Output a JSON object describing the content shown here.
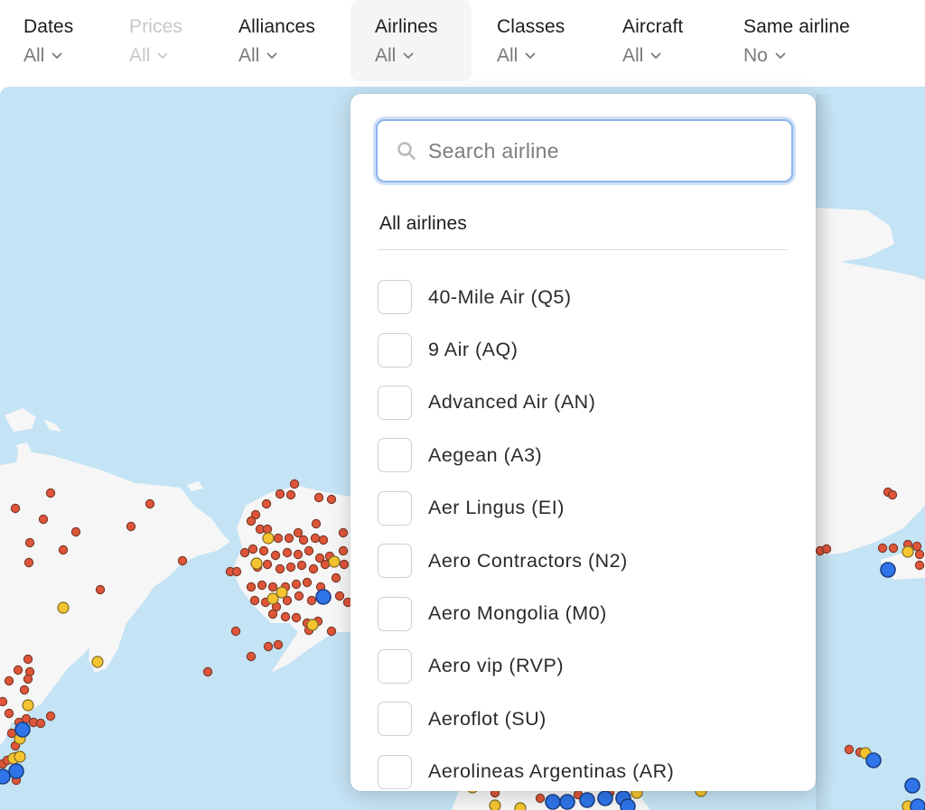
{
  "filters": [
    {
      "label": "Dates",
      "value": "All",
      "state": "normal"
    },
    {
      "label": "Prices",
      "value": "All",
      "state": "disabled"
    },
    {
      "label": "Alliances",
      "value": "All",
      "state": "normal"
    },
    {
      "label": "Airlines",
      "value": "All",
      "state": "active"
    },
    {
      "label": "Classes",
      "value": "All",
      "state": "normal"
    },
    {
      "label": "Aircraft",
      "value": "All",
      "state": "normal"
    },
    {
      "label": "Same airline",
      "value": "No",
      "state": "normal"
    }
  ],
  "airline_dropdown": {
    "search": {
      "placeholder": "Search airline",
      "value": "",
      "icon": "search-icon"
    },
    "section_title": "All airlines",
    "airlines": [
      {
        "name": "40-Mile Air (Q5)",
        "checked": false
      },
      {
        "name": "9 Air (AQ)",
        "checked": false
      },
      {
        "name": "Advanced Air (AN)",
        "checked": false
      },
      {
        "name": "Aegean (A3)",
        "checked": false
      },
      {
        "name": "Aer Lingus (EI)",
        "checked": false
      },
      {
        "name": "Aero Contractors (N2)",
        "checked": false
      },
      {
        "name": "Aero Mongolia (M0)",
        "checked": false
      },
      {
        "name": "Aero vip (RVP)",
        "checked": false
      },
      {
        "name": "Aeroflot (SU)",
        "checked": false
      },
      {
        "name": "Aerolineas Argentinas (AR)",
        "checked": false
      }
    ]
  },
  "map": {
    "colors": {
      "water": "#c4e3f4",
      "land": "#f6f6f6",
      "airport_small": "#e0553a",
      "airport_medium": "#f4c430",
      "airport_large": "#2f74e8",
      "marker_stroke": "#7a3b28"
    }
  }
}
